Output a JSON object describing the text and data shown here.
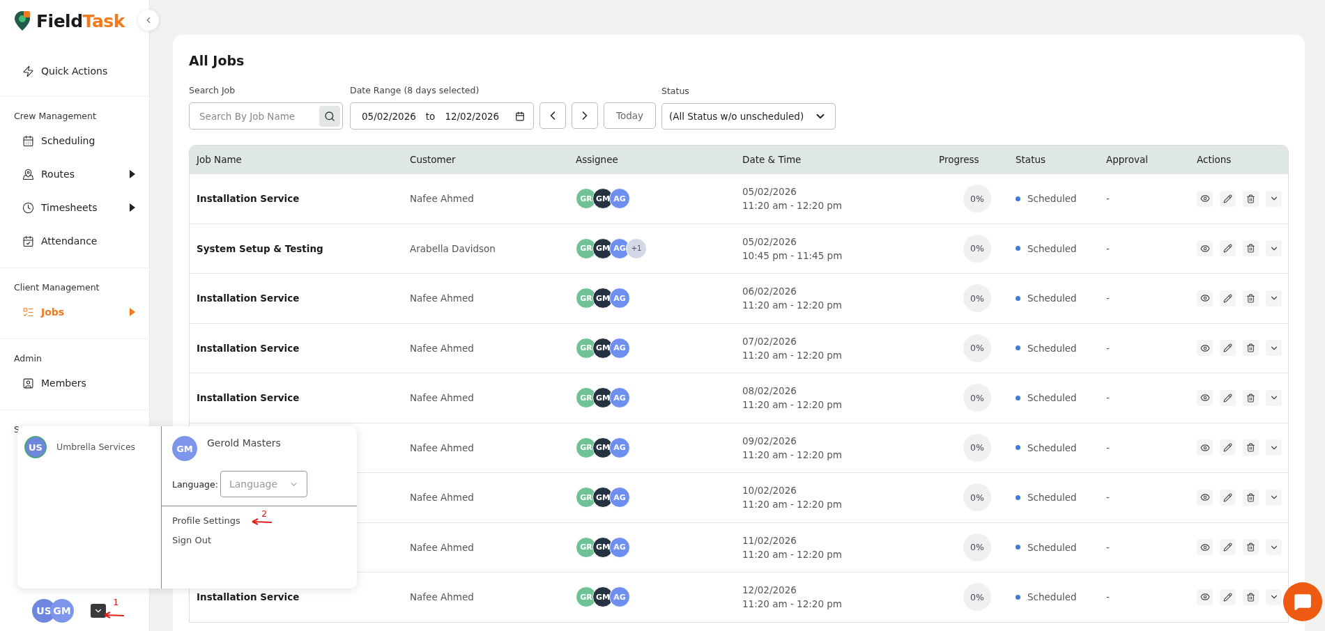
{
  "logo": {
    "first": "Field",
    "second": "Task"
  },
  "sidebar": {
    "top_item": {
      "label": "Quick Actions",
      "selected": false
    },
    "sections": [
      {
        "title": "Crew Management",
        "items": [
          {
            "label": "Scheduling",
            "selected": false,
            "submenu": false
          },
          {
            "label": "Routes",
            "selected": false,
            "submenu": true
          },
          {
            "label": "Timesheets",
            "selected": false,
            "submenu": true
          },
          {
            "label": "Attendance",
            "selected": false,
            "submenu": false
          }
        ]
      },
      {
        "title": "Client Management",
        "items": [
          {
            "label": "Jobs",
            "selected": true,
            "submenu": true
          }
        ]
      },
      {
        "title": "Admin",
        "items": [
          {
            "label": "Members",
            "selected": false,
            "submenu": false
          }
        ]
      },
      {
        "title": "S"
      }
    ],
    "footer": {
      "avatars": [
        {
          "initials": "US",
          "color": "#6f86de"
        },
        {
          "initials": "GM",
          "color": "#7d96ec"
        }
      ],
      "annotation": "1"
    }
  },
  "account_menu": {
    "company": {
      "initials": "US",
      "name": "Umbrella Services"
    },
    "user": {
      "initials": "GM",
      "name": "Gerold Masters"
    },
    "language_label": "Language:",
    "language_placeholder": "Language",
    "links": [
      {
        "label": "Profile Settings",
        "annotation": "2"
      },
      {
        "label": "Sign Out"
      }
    ]
  },
  "page": {
    "title": "All Jobs",
    "filters": {
      "search_label": "Search Job",
      "search_placeholder": "Search By Job Name",
      "date_label": "Date Range (8 days selected)",
      "date_from": "05/02/2026",
      "date_to_word": "to",
      "date_to": "12/02/2026",
      "today": "Today",
      "status_label": "Status",
      "status_value": "(All Status w/o unscheduled)"
    },
    "table": {
      "columns": [
        "Job Name",
        "Customer",
        "Assignee",
        "Date & Time",
        "Progress",
        "Status",
        "Approval",
        "Actions"
      ],
      "rows": [
        {
          "job": "Installation Service",
          "customer": "Nafee Ahmed",
          "assignees": [
            {
              "initials": "GR",
              "color": "#6fc295"
            },
            {
              "initials": "GM",
              "color": "#243242"
            },
            {
              "initials": "AG",
              "color": "#6f8ff0"
            }
          ],
          "date": "05/02/2026",
          "time": "11:20 am - 12:20 pm",
          "progress": "0%",
          "status": "Scheduled",
          "approval": "-"
        },
        {
          "job": "System Setup & Testing",
          "customer": "Arabella Davidson",
          "assignees": [
            {
              "initials": "GR",
              "color": "#6fc295"
            },
            {
              "initials": "GM",
              "color": "#243242"
            },
            {
              "initials": "AG",
              "color": "#6f8ff0"
            }
          ],
          "extra": "+1",
          "date": "05/02/2026",
          "time": "10:45 pm - 11:45 pm",
          "progress": "0%",
          "status": "Scheduled",
          "approval": "-"
        },
        {
          "job": "Installation Service",
          "customer": "Nafee Ahmed",
          "assignees": [
            {
              "initials": "GR",
              "color": "#6fc295"
            },
            {
              "initials": "GM",
              "color": "#243242"
            },
            {
              "initials": "AG",
              "color": "#6f8ff0"
            }
          ],
          "date": "06/02/2026",
          "time": "11:20 am - 12:20 pm",
          "progress": "0%",
          "status": "Scheduled",
          "approval": "-"
        },
        {
          "job": "Installation Service",
          "customer": "Nafee Ahmed",
          "assignees": [
            {
              "initials": "GR",
              "color": "#6fc295"
            },
            {
              "initials": "GM",
              "color": "#243242"
            },
            {
              "initials": "AG",
              "color": "#6f8ff0"
            }
          ],
          "date": "07/02/2026",
          "time": "11:20 am - 12:20 pm",
          "progress": "0%",
          "status": "Scheduled",
          "approval": "-"
        },
        {
          "job": "Installation Service",
          "customer": "Nafee Ahmed",
          "assignees": [
            {
              "initials": "GR",
              "color": "#6fc295"
            },
            {
              "initials": "GM",
              "color": "#243242"
            },
            {
              "initials": "AG",
              "color": "#6f8ff0"
            }
          ],
          "date": "08/02/2026",
          "time": "11:20 am - 12:20 pm",
          "progress": "0%",
          "status": "Scheduled",
          "approval": "-"
        },
        {
          "customer": "Nafee Ahmed",
          "assignees": [
            {
              "initials": "GR",
              "color": "#6fc295"
            },
            {
              "initials": "GM",
              "color": "#243242"
            },
            {
              "initials": "AG",
              "color": "#6f8ff0"
            }
          ],
          "date": "09/02/2026",
          "time": "11:20 am - 12:20 pm",
          "progress": "0%",
          "status": "Scheduled",
          "approval": "-"
        },
        {
          "customer": "Nafee Ahmed",
          "assignees": [
            {
              "initials": "GR",
              "color": "#6fc295"
            },
            {
              "initials": "GM",
              "color": "#243242"
            },
            {
              "initials": "AG",
              "color": "#6f8ff0"
            }
          ],
          "date": "10/02/2026",
          "time": "11:20 am - 12:20 pm",
          "progress": "0%",
          "status": "Scheduled",
          "approval": "-"
        },
        {
          "customer": "Nafee Ahmed",
          "assignees": [
            {
              "initials": "GR",
              "color": "#6fc295"
            },
            {
              "initials": "GM",
              "color": "#243242"
            },
            {
              "initials": "AG",
              "color": "#6f8ff0"
            }
          ],
          "date": "11/02/2026",
          "time": "11:20 am - 12:20 pm",
          "progress": "0%",
          "status": "Scheduled",
          "approval": "-"
        },
        {
          "job": "Installation Service",
          "customer": "Nafee Ahmed",
          "assignees": [
            {
              "initials": "GR",
              "color": "#6fc295"
            },
            {
              "initials": "GM",
              "color": "#243242"
            },
            {
              "initials": "AG",
              "color": "#6f8ff0"
            }
          ],
          "date": "12/02/2026",
          "time": "11:20 am - 12:20 pm",
          "progress": "0%",
          "status": "Scheduled",
          "approval": "-"
        }
      ]
    }
  }
}
